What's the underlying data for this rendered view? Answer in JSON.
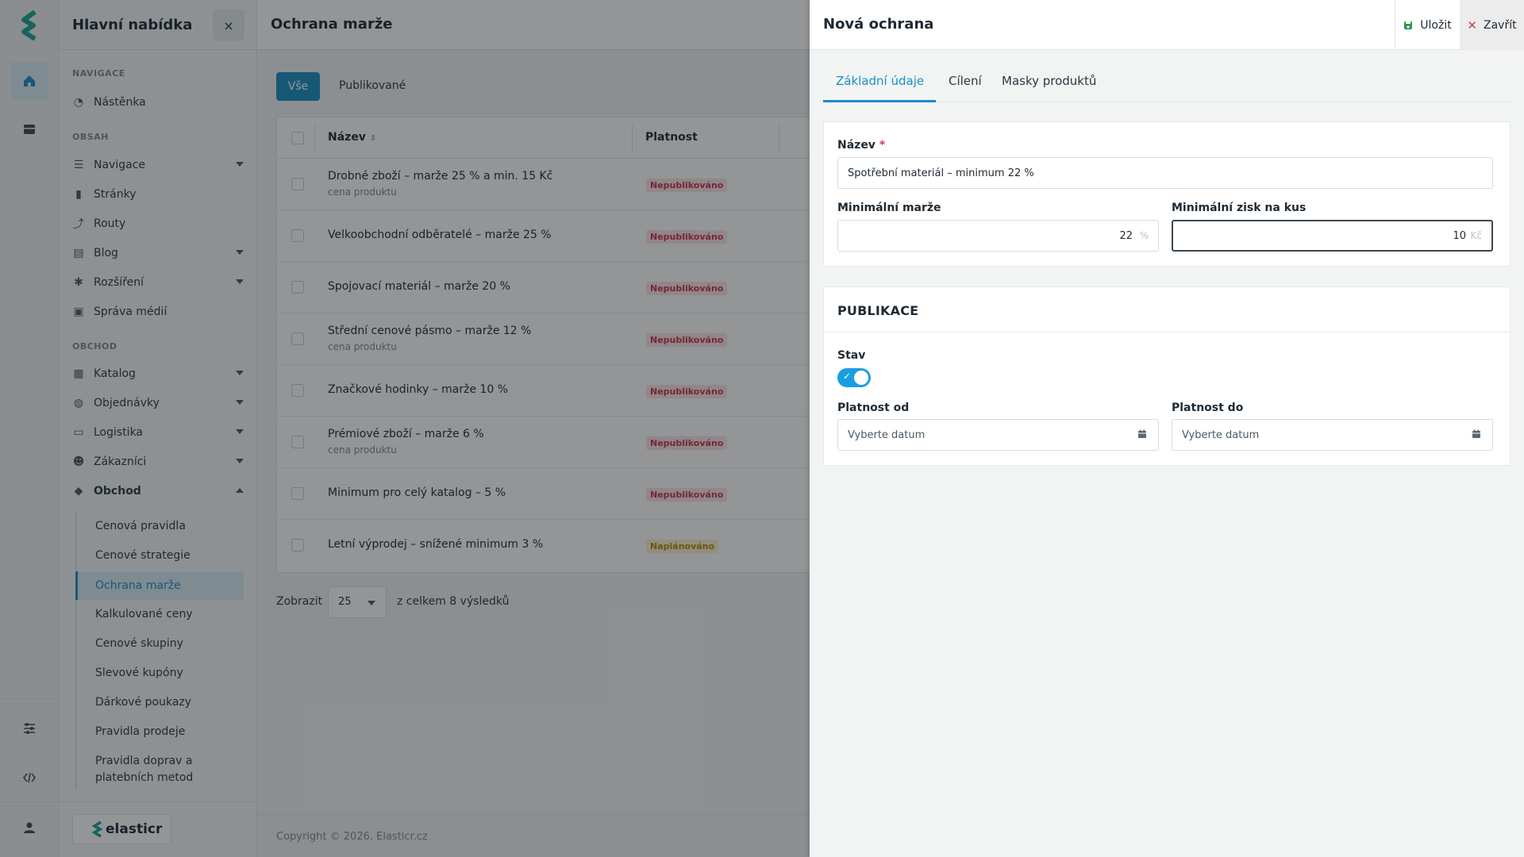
{
  "rail": {
    "items": [
      "home",
      "layout",
      "settings",
      "code",
      "user"
    ]
  },
  "sidebar": {
    "title": "Hlavní nabídka",
    "close_label": "×",
    "sections": {
      "navigace": "NAVIGACE",
      "obsah": "OBSAH",
      "obchod": "OBCHOD"
    },
    "items": {
      "nastenka": "Nástěnka",
      "navigace": "Navigace",
      "stranky": "Stránky",
      "routy": "Routy",
      "blog": "Blog",
      "rozsireni": "Rozšíření",
      "sprava_medii": "Správa médií",
      "katalog": "Katalog",
      "objednavky": "Objednávky",
      "logistika": "Logistika",
      "zakaznici": "Zákazníci",
      "obchod": "Obchod"
    },
    "sub_items": [
      "Cenová pravidla",
      "Cenové strategie",
      "Ochrana marže",
      "Kalkulované ceny",
      "Cenové skupiny",
      "Slevové kupóny",
      "Dárkové poukazy",
      "Pravidla prodeje",
      "Pravidla doprav a",
      "platebních metod"
    ],
    "brand": "elasticr"
  },
  "main": {
    "title": "Ochrana marže",
    "filters": {
      "all": "Vše",
      "published": "Publikované"
    },
    "columns": {
      "name": "Název",
      "validity": "Platnost"
    },
    "rows": [
      {
        "name": "Drobné zboží – marže 25 % a min. 15 Kč",
        "sub": "cena produktu",
        "status": "Nepublikováno"
      },
      {
        "name": "Velkoobchodní odběratelé – marže 25 %",
        "sub": "",
        "status": "Nepublikováno"
      },
      {
        "name": "Spojovací materiál – marže 20 %",
        "sub": "",
        "status": "Nepublikováno"
      },
      {
        "name": "Střední cenové pásmo – marže 12 %",
        "sub": "cena produktu",
        "status": "Nepublikováno"
      },
      {
        "name": "Značkové hodinky – marže 10 %",
        "sub": "",
        "status": "Nepublikováno"
      },
      {
        "name": "Prémiové zboží – marže 6 %",
        "sub": "cena produktu",
        "status": "Nepublikováno"
      },
      {
        "name": "Minimum pro celý katalog – 5 %",
        "sub": "",
        "status": "Nepublikováno"
      },
      {
        "name": "Letní výprodej – snížené minimum 3 %",
        "sub": "",
        "status": "Naplánováno"
      }
    ],
    "pager": {
      "label": "Zobrazit",
      "value": "25",
      "total": "z celkem 8 výsledků"
    },
    "copyright": "Copyright © 2026, Elasticr.cz"
  },
  "drawer": {
    "title": "Nová ochrana",
    "save_label": "Uložit",
    "close_label": "Zavřít",
    "tabs": [
      "Základní údaje",
      "Cílení",
      "Masky produktů"
    ],
    "form": {
      "name_label": "Název",
      "required_mark": "*",
      "name_value": "Spotřební materiál – minimum 22 %",
      "min_margin_label": "Minimální marže",
      "min_margin_value": "22",
      "min_margin_unit": "%",
      "min_profit_label": "Minimální zisk na kus",
      "min_profit_value": "10",
      "min_profit_unit": "Kč"
    },
    "publication": {
      "title": "PUBLIKACE",
      "status_label": "Stav",
      "status_on": true,
      "valid_from_label": "Platnost od",
      "valid_from_placeholder": "Vyberte datum",
      "valid_to_label": "Platnost do",
      "valid_to_placeholder": "Vyberte datum"
    }
  },
  "colors": {
    "accent": "#1a8ec4",
    "toggle": "#1a9ee0",
    "danger": "#c9344c"
  }
}
